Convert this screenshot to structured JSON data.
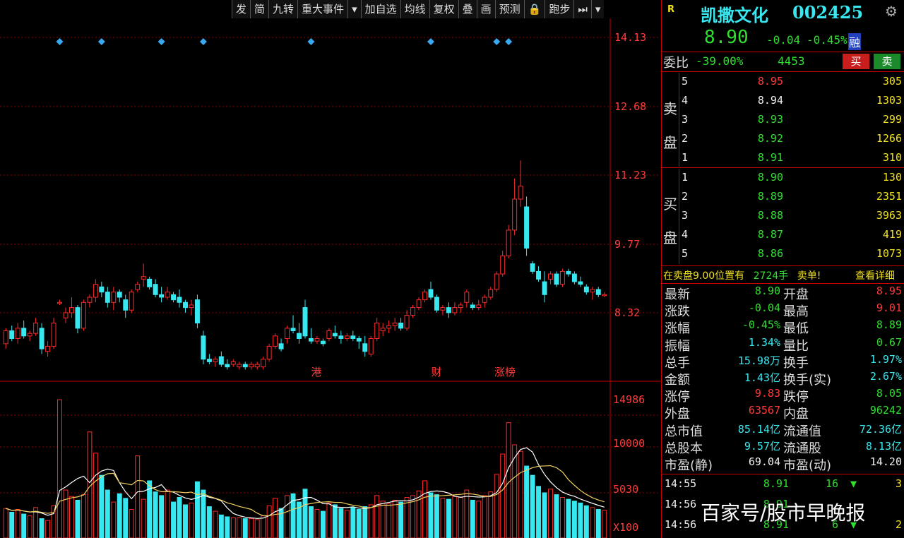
{
  "toolbar": [
    "发",
    "简",
    "九转",
    "重大事件",
    "▾",
    "加自选",
    "均线",
    "复权",
    "叠",
    "画",
    "预测",
    "🔒",
    "跑步",
    "⏭",
    "▾"
  ],
  "price_axis": [
    "14.13",
    "12.68",
    "11.23",
    "9.77",
    "8.32"
  ],
  "volume_axis": [
    "14986",
    "10000",
    "5030",
    "X100"
  ],
  "event_markers": [
    "港",
    "财",
    "涨榜"
  ],
  "colors": {
    "up": "#ff2a2a",
    "down": "#38e8f0",
    "ma5": "#ffffff",
    "ma10": "#f0d060",
    "grid": "#8b0000"
  },
  "stock": {
    "tag": "R",
    "name": "凯撒文化",
    "code": "002425",
    "price": "8.90",
    "change": "-0.04",
    "pct": "-0.45%",
    "badge": "融"
  },
  "weibi": {
    "label": "委比",
    "ratio": "-39.00%",
    "diff": "4453",
    "buy": "买",
    "sell": "卖"
  },
  "sell_label": [
    "卖",
    "盘"
  ],
  "buy_label": [
    "买",
    "盘"
  ],
  "asks": [
    {
      "lvl": "5",
      "price": "8.95",
      "vol": "305",
      "c": "red"
    },
    {
      "lvl": "4",
      "price": "8.94",
      "vol": "1303",
      "c": "white"
    },
    {
      "lvl": "3",
      "price": "8.93",
      "vol": "299",
      "c": "green"
    },
    {
      "lvl": "2",
      "price": "8.92",
      "vol": "1266",
      "c": "green"
    },
    {
      "lvl": "1",
      "price": "8.91",
      "vol": "310",
      "c": "green"
    }
  ],
  "bids": [
    {
      "lvl": "1",
      "price": "8.90",
      "vol": "130",
      "c": "green"
    },
    {
      "lvl": "2",
      "price": "8.89",
      "vol": "2351",
      "c": "green"
    },
    {
      "lvl": "3",
      "price": "8.88",
      "vol": "3963",
      "c": "green"
    },
    {
      "lvl": "4",
      "price": "8.87",
      "vol": "419",
      "c": "green"
    },
    {
      "lvl": "5",
      "price": "8.86",
      "vol": "1073",
      "c": "green"
    }
  ],
  "notice": {
    "text": "在卖盘9.00位置有",
    "vol": "2724手",
    "kind": "卖单!",
    "link": "查看详细"
  },
  "stats": [
    {
      "l1": "最新",
      "v1": "8.90",
      "c1": "green",
      "l2": "开盘",
      "v2": "8.95",
      "c2": "red"
    },
    {
      "l1": "涨跌",
      "v1": "-0.04",
      "c1": "green",
      "l2": "最高",
      "v2": "9.01",
      "c2": "red"
    },
    {
      "l1": "涨幅",
      "v1": "-0.45%",
      "c1": "green",
      "l2": "最低",
      "v2": "8.89",
      "c2": "green"
    },
    {
      "l1": "振幅",
      "v1": "1.34%",
      "c1": "cyan",
      "l2": "量比",
      "v2": "0.67",
      "c2": "green"
    },
    {
      "l1": "总手",
      "v1": "15.98万",
      "c1": "cyan",
      "l2": "换手",
      "v2": "1.97%",
      "c2": "cyan"
    },
    {
      "l1": "金额",
      "v1": "1.43亿",
      "c1": "cyan",
      "l2": "换手(实)",
      "v2": "2.67%",
      "c2": "cyan"
    },
    {
      "l1": "涨停",
      "v1": "9.83",
      "c1": "red",
      "l2": "跌停",
      "v2": "8.05",
      "c2": "green"
    },
    {
      "l1": "外盘",
      "v1": "63567",
      "c1": "red",
      "l2": "内盘",
      "v2": "96242",
      "c2": "green"
    },
    {
      "l1": "总市值",
      "v1": "85.14亿",
      "c1": "cyan",
      "l2": "流通值",
      "v2": "72.36亿",
      "c2": "cyan"
    },
    {
      "l1": "总股本",
      "v1": "9.57亿",
      "c1": "cyan",
      "l2": "流通股",
      "v2": "8.13亿",
      "c2": "cyan"
    },
    {
      "l1": "市盈(静)",
      "v1": "69.04",
      "c1": "white",
      "l2": "市盈(动)",
      "v2": "14.20",
      "c2": "white"
    }
  ],
  "ticks": [
    {
      "time": "14:55",
      "price": "8.91",
      "vol": "16",
      "arrow": "▼",
      "n": "3"
    },
    {
      "time": "14:56",
      "price": "8.91",
      "vol": "",
      "arrow": "",
      "n": ""
    },
    {
      "time": "14:56",
      "price": "8.91",
      "vol": "6",
      "arrow": "▼",
      "n": "2"
    }
  ],
  "watermark": "百家号/股市早晚报",
  "chart_data": {
    "type": "candlestick",
    "ylim": [
      7.5,
      14.5
    ],
    "ohlc": [
      [
        8.2,
        8.5,
        8.1,
        8.45
      ],
      [
        8.45,
        8.55,
        8.25,
        8.3
      ],
      [
        8.3,
        8.6,
        8.2,
        8.5
      ],
      [
        8.5,
        8.65,
        8.3,
        8.35
      ],
      [
        8.35,
        8.45,
        8.25,
        8.4
      ],
      [
        8.4,
        8.7,
        8.35,
        8.6
      ],
      [
        8.5,
        8.6,
        8.0,
        8.1
      ],
      [
        8.05,
        8.25,
        7.95,
        8.15
      ],
      [
        8.15,
        8.7,
        8.1,
        8.6
      ],
      [
        9.0,
        9.05,
        8.95,
        9.0
      ],
      [
        8.7,
        8.9,
        8.6,
        8.8
      ],
      [
        8.8,
        9.1,
        8.7,
        8.9
      ],
      [
        8.9,
        8.95,
        8.4,
        8.5
      ],
      [
        8.5,
        9.05,
        8.45,
        9.0
      ],
      [
        9.0,
        9.15,
        8.9,
        9.1
      ],
      [
        9.1,
        9.45,
        9.0,
        9.35
      ],
      [
        9.3,
        9.4,
        9.1,
        9.2
      ],
      [
        9.2,
        9.3,
        8.9,
        9.0
      ],
      [
        9.0,
        9.3,
        8.85,
        9.2
      ],
      [
        9.2,
        9.25,
        9.0,
        9.1
      ],
      [
        9.05,
        9.15,
        8.7,
        8.85
      ],
      [
        8.85,
        9.25,
        8.8,
        9.2
      ],
      [
        9.25,
        9.4,
        9.2,
        9.35
      ],
      [
        9.45,
        9.75,
        9.3,
        9.5
      ],
      [
        9.45,
        9.5,
        9.25,
        9.3
      ],
      [
        9.35,
        9.45,
        9.1,
        9.15
      ],
      [
        9.15,
        9.3,
        9.0,
        9.1
      ],
      [
        9.1,
        9.3,
        9.05,
        9.2
      ],
      [
        9.15,
        9.2,
        9.0,
        9.05
      ],
      [
        9.1,
        9.25,
        8.9,
        9.0
      ],
      [
        9.0,
        9.05,
        8.8,
        8.9
      ],
      [
        8.9,
        9.05,
        8.75,
        8.95
      ],
      [
        9.05,
        9.15,
        8.5,
        8.6
      ],
      [
        8.35,
        8.45,
        7.8,
        7.9
      ],
      [
        7.9,
        8.0,
        7.8,
        7.85
      ],
      [
        7.85,
        7.95,
        7.75,
        7.9
      ],
      [
        7.95,
        8.05,
        7.75,
        7.8
      ],
      [
        7.8,
        7.9,
        7.7,
        7.75
      ],
      [
        7.8,
        7.9,
        7.75,
        7.85
      ],
      [
        7.75,
        7.85,
        7.7,
        7.8
      ],
      [
        7.8,
        7.85,
        7.7,
        7.75
      ],
      [
        7.75,
        7.85,
        7.7,
        7.8
      ],
      [
        7.75,
        7.85,
        7.7,
        7.8
      ],
      [
        7.75,
        7.95,
        7.7,
        7.9
      ],
      [
        7.9,
        8.2,
        7.85,
        8.15
      ],
      [
        8.15,
        8.4,
        8.1,
        8.35
      ],
      [
        8.2,
        8.3,
        8.05,
        8.1
      ],
      [
        8.3,
        8.55,
        8.2,
        8.5
      ],
      [
        8.5,
        8.75,
        8.4,
        8.45
      ],
      [
        8.4,
        8.6,
        8.2,
        8.3
      ],
      [
        8.9,
        9.05,
        8.3,
        8.35
      ],
      [
        8.3,
        8.5,
        8.2,
        8.25
      ],
      [
        8.25,
        8.35,
        8.2,
        8.3
      ],
      [
        8.25,
        8.3,
        8.15,
        8.2
      ],
      [
        8.3,
        8.5,
        8.25,
        8.45
      ],
      [
        8.4,
        8.55,
        8.3,
        8.35
      ],
      [
        8.35,
        8.45,
        8.2,
        8.3
      ],
      [
        8.3,
        8.4,
        8.25,
        8.35
      ],
      [
        8.35,
        8.45,
        8.25,
        8.3
      ],
      [
        8.3,
        8.35,
        8.1,
        8.25
      ],
      [
        8.2,
        8.35,
        7.95,
        8.05
      ],
      [
        8.0,
        8.35,
        7.95,
        8.3
      ],
      [
        8.3,
        8.7,
        8.25,
        8.6
      ],
      [
        8.45,
        8.6,
        8.35,
        8.5
      ],
      [
        8.5,
        8.65,
        8.4,
        8.55
      ],
      [
        8.55,
        8.7,
        8.45,
        8.6
      ],
      [
        8.6,
        8.7,
        8.45,
        8.5
      ],
      [
        8.5,
        8.85,
        8.45,
        8.75
      ],
      [
        8.75,
        8.95,
        8.7,
        8.9
      ],
      [
        8.9,
        9.1,
        8.85,
        9.05
      ],
      [
        9.05,
        9.25,
        9.0,
        9.2
      ],
      [
        9.25,
        9.4,
        9.05,
        9.1
      ],
      [
        9.1,
        9.15,
        8.8,
        8.85
      ],
      [
        8.85,
        8.95,
        8.75,
        8.9
      ],
      [
        8.9,
        9.0,
        8.7,
        8.8
      ],
      [
        8.8,
        9.0,
        8.75,
        8.9
      ],
      [
        8.9,
        9.0,
        8.8,
        8.95
      ],
      [
        9.0,
        9.25,
        8.9,
        9.2
      ],
      [
        8.95,
        9.0,
        8.85,
        8.9
      ],
      [
        8.9,
        9.05,
        8.85,
        8.95
      ],
      [
        9.0,
        9.15,
        8.9,
        9.1
      ],
      [
        9.1,
        9.3,
        9.05,
        9.25
      ],
      [
        9.25,
        9.6,
        9.2,
        9.55
      ],
      [
        9.55,
        10.0,
        9.5,
        9.9
      ],
      [
        9.9,
        10.5,
        9.85,
        10.4
      ],
      [
        10.4,
        11.4,
        10.3,
        11.0
      ],
      [
        11.0,
        11.75,
        10.85,
        11.25
      ],
      [
        10.85,
        11.05,
        9.9,
        10.05
      ],
      [
        9.75,
        9.8,
        9.55,
        9.6
      ],
      [
        9.6,
        9.7,
        9.4,
        9.45
      ],
      [
        9.4,
        9.6,
        9.0,
        9.15
      ],
      [
        9.45,
        9.6,
        9.35,
        9.55
      ],
      [
        9.55,
        9.6,
        9.3,
        9.35
      ],
      [
        9.35,
        9.65,
        9.3,
        9.6
      ],
      [
        9.6,
        9.65,
        9.5,
        9.55
      ],
      [
        9.55,
        9.6,
        9.35,
        9.4
      ],
      [
        9.4,
        9.5,
        9.3,
        9.35
      ],
      [
        9.3,
        9.35,
        9.15,
        9.2
      ],
      [
        9.2,
        9.3,
        9.05,
        9.25
      ],
      [
        9.25,
        9.3,
        9.1,
        9.15
      ],
      [
        9.15,
        9.2,
        9.1,
        9.15
      ]
    ],
    "volume": [
      3200,
      2800,
      3100,
      2600,
      2400,
      3300,
      2100,
      1900,
      3500,
      14986,
      5200,
      4500,
      4100,
      4700,
      11500,
      9200,
      6800,
      5200,
      3900,
      4800,
      4300,
      3100,
      8900,
      4200,
      6200,
      5000,
      4600,
      5200,
      3900,
      4400,
      3600,
      3800,
      6100,
      5200,
      3400,
      2900,
      2500,
      2300,
      2200,
      2200,
      2100,
      2100,
      2000,
      2400,
      3500,
      4300,
      3200,
      4600,
      4800,
      3900,
      5300,
      3400,
      3100,
      2900,
      3800,
      3600,
      3200,
      3000,
      3300,
      3100,
      3400,
      3600,
      4600,
      4000,
      3700,
      4100,
      3900,
      4400,
      4600,
      5100,
      6200,
      4900,
      4700,
      4300,
      4200,
      4500,
      4400,
      5200,
      4100,
      4000,
      4600,
      5000,
      6900,
      9100,
      12500,
      10100,
      9400,
      7800,
      6800,
      5600,
      4900,
      5300,
      4700,
      4400,
      4200,
      4000,
      3800,
      3500,
      3300,
      3100,
      3000
    ]
  }
}
